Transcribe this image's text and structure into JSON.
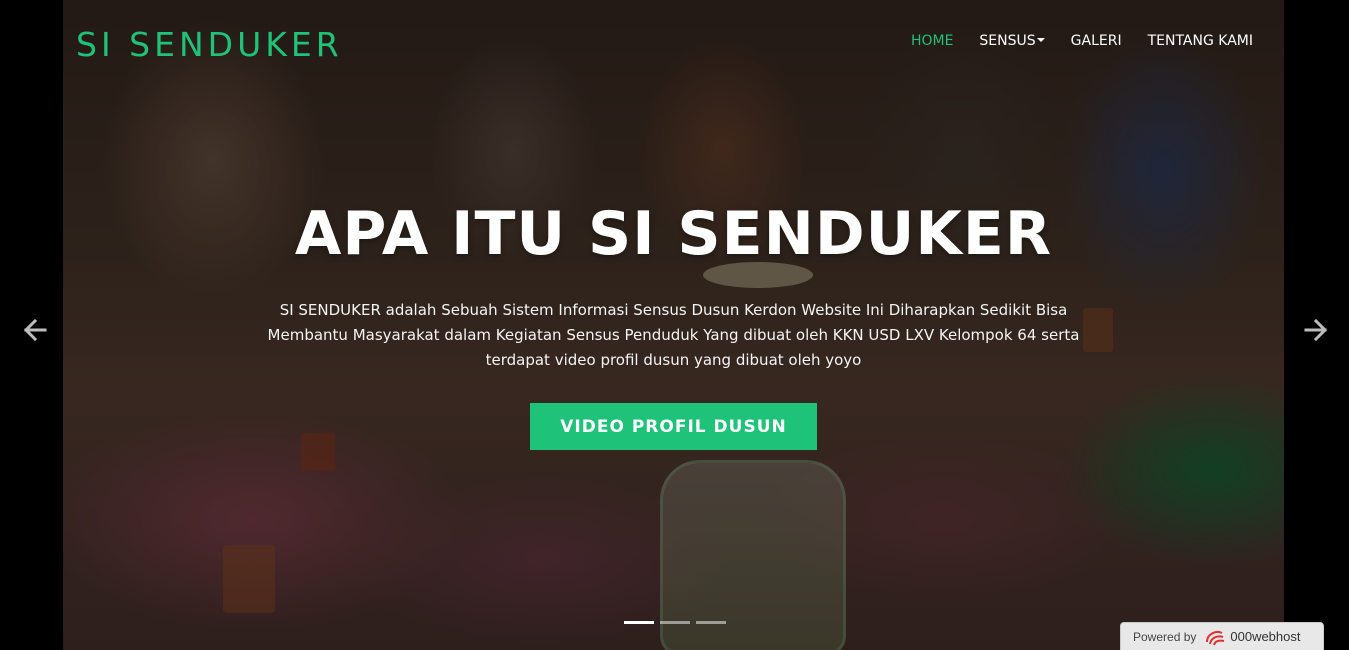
{
  "brand": {
    "name": "SI SENDUKER"
  },
  "nav": {
    "items": [
      {
        "label": "HOME",
        "active": true
      },
      {
        "label": "SENSUS",
        "dropdown": true
      },
      {
        "label": "GALERI"
      },
      {
        "label": "TENTANG KAMI"
      }
    ]
  },
  "hero": {
    "title": "APA ITU SI SENDUKER",
    "description": "SI SENDUKER adalah Sebuah Sistem Informasi Sensus Dusun Kerdon Website Ini Diharapkan Sedikit Bisa Membantu Masyarakat dalam Kegiatan Sensus Penduduk Yang dibuat oleh KKN USD LXV Kelompok 64 serta terdapat video profil dusun yang dibuat oleh yoyo",
    "cta_label": "VIDEO PROFIL DUSUN"
  },
  "carousel": {
    "prev_icon": "arrow-left-icon",
    "next_icon": "arrow-right-icon",
    "slide_count": 3,
    "active_slide": 1
  },
  "badge": {
    "powered_by": "Powered by",
    "host": "000webhost",
    "logo_icon": "000webhost-logo-icon"
  },
  "colors": {
    "accent": "#1ec279",
    "text": "#ffffff",
    "background": "#000000"
  }
}
